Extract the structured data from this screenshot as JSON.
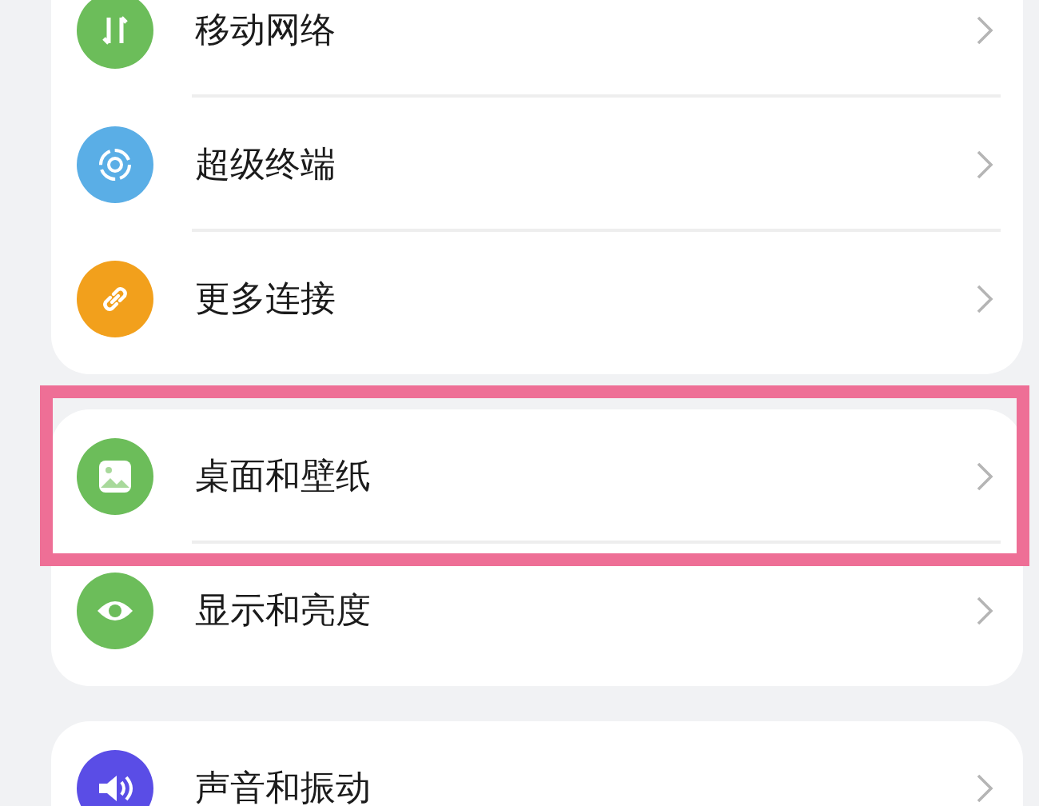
{
  "groups": [
    {
      "items": [
        {
          "label": "移动网络",
          "color": "#6cbd5a",
          "highlighted": false
        },
        {
          "label": "超级终端",
          "color": "#5aaee6",
          "highlighted": false
        },
        {
          "label": "更多连接",
          "color": "#f2a01c",
          "highlighted": false
        }
      ]
    },
    {
      "items": [
        {
          "label": "桌面和壁纸",
          "color": "#6cbd5a",
          "highlighted": true
        },
        {
          "label": "显示和亮度",
          "color": "#6cbd5a",
          "highlighted": false
        }
      ]
    },
    {
      "items": [
        {
          "label": "声音和振动",
          "color": "#5a4de6",
          "highlighted": false
        }
      ]
    }
  ]
}
